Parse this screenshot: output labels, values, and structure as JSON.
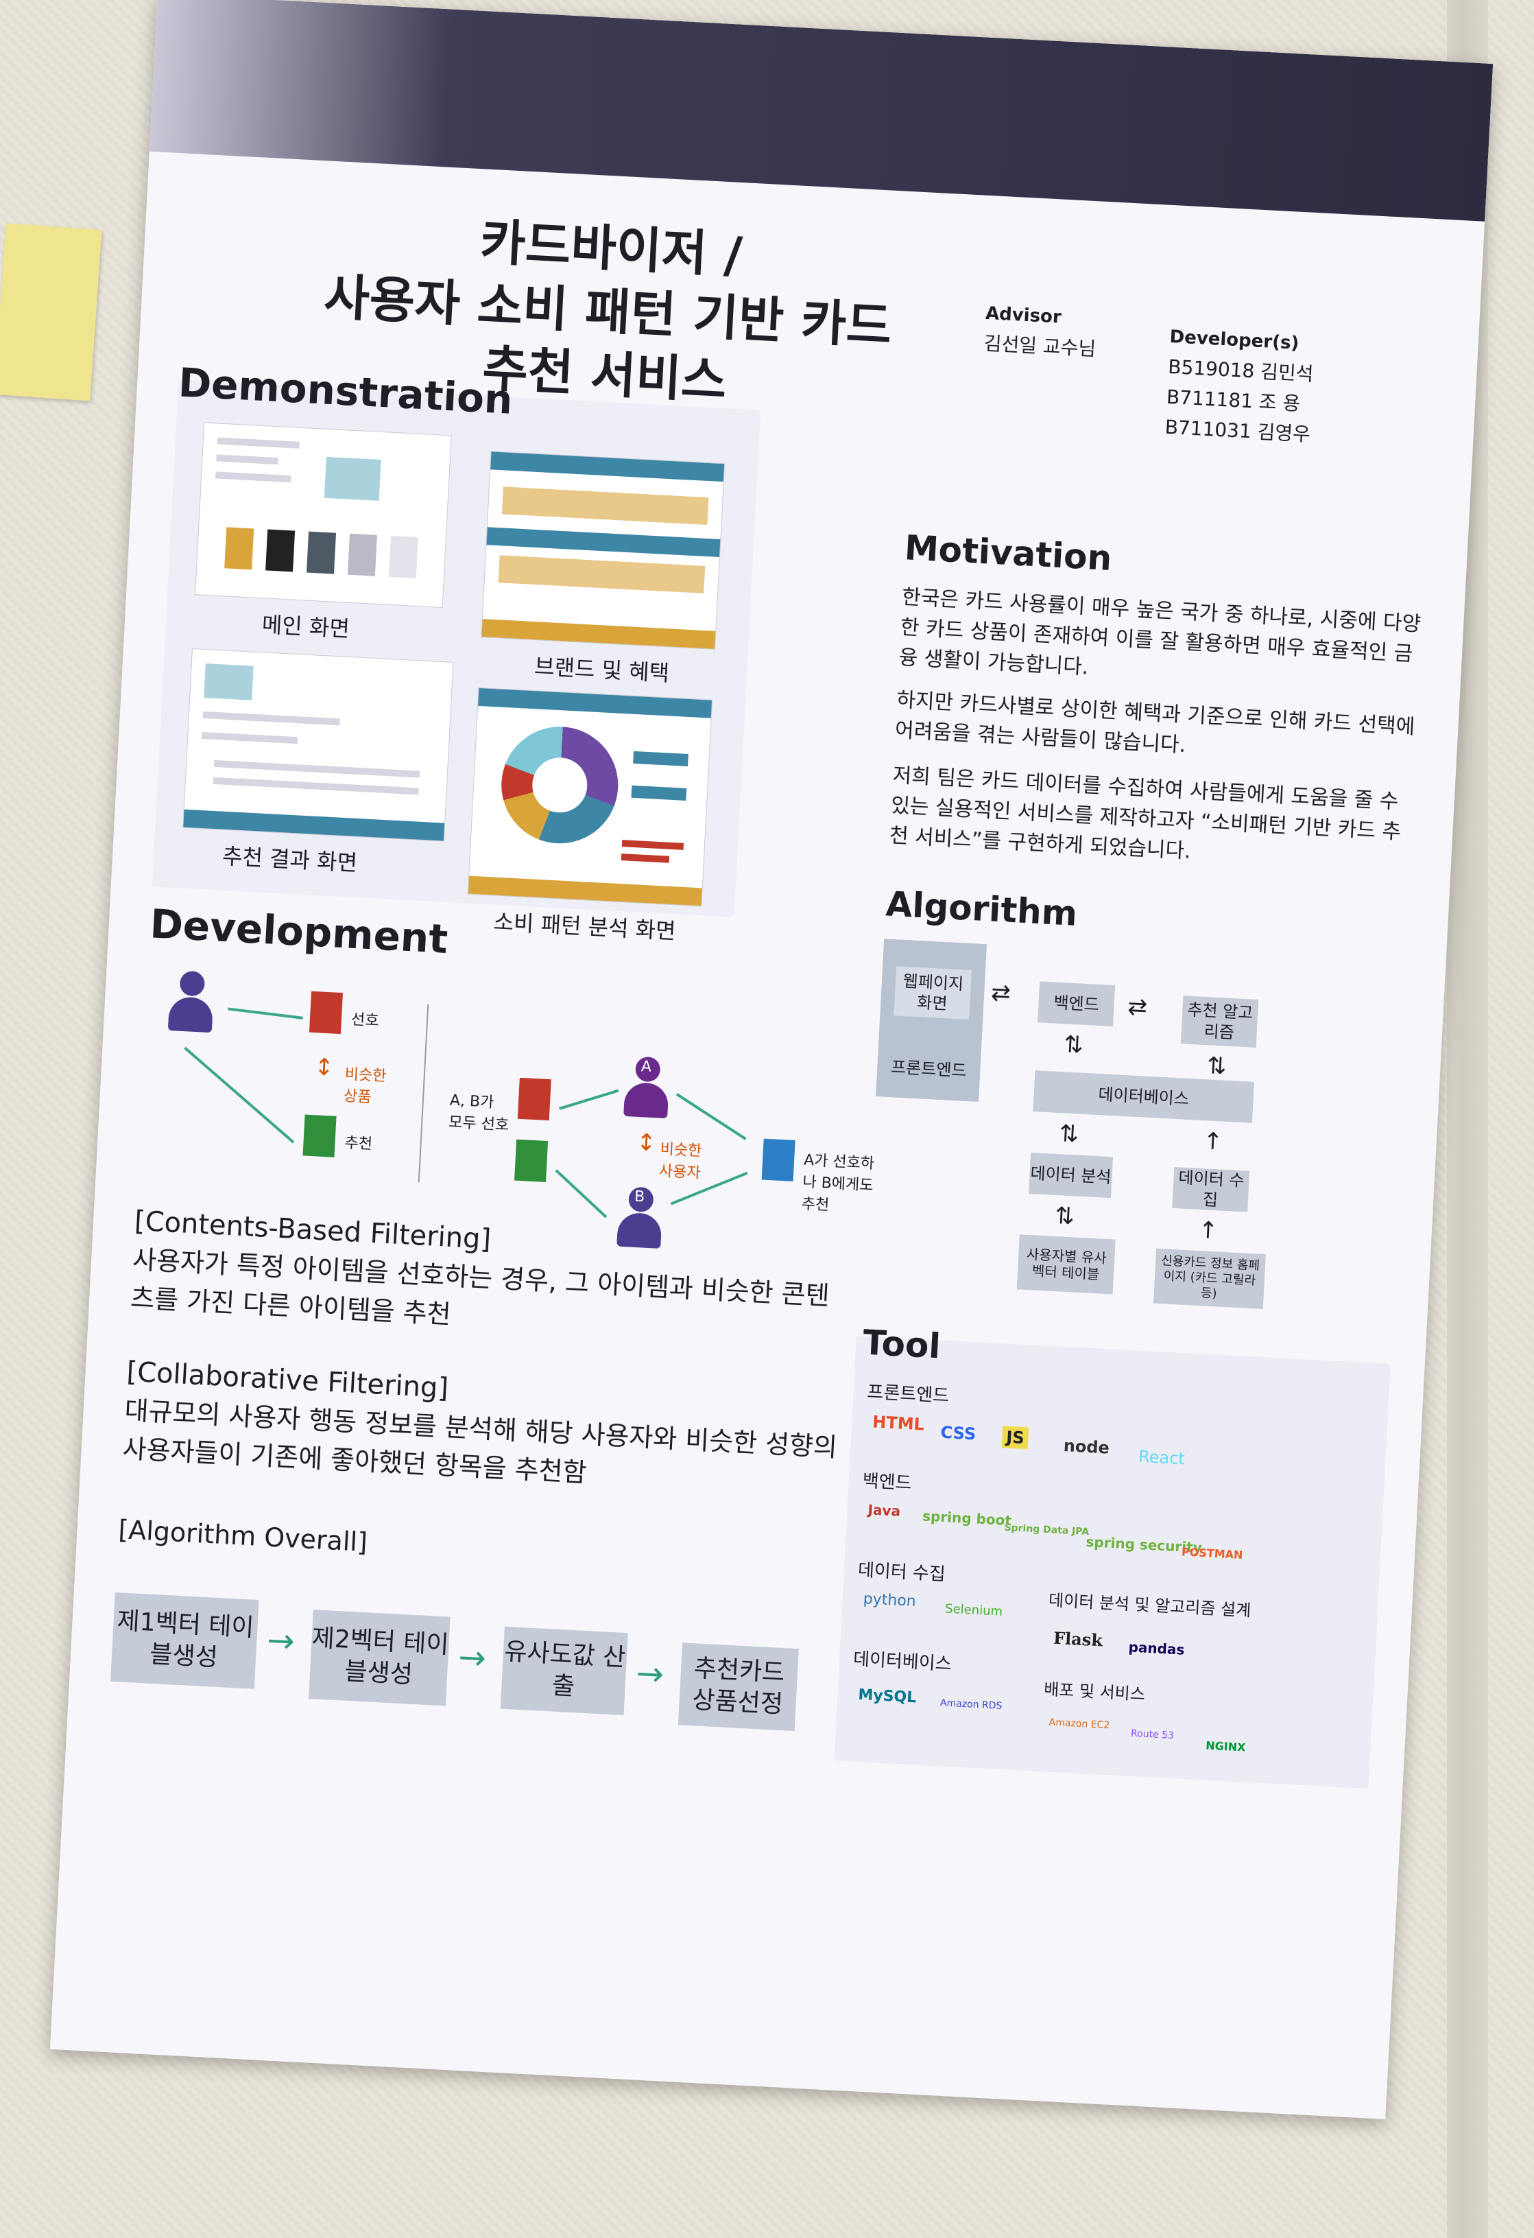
{
  "title": {
    "line1": "카드바이저 /",
    "line2": "사용자 소비 패턴 기반 카드",
    "line3": "추천 서비스"
  },
  "advisor": {
    "label": "Advisor",
    "name": "김선일 교수님"
  },
  "developers": {
    "label": "Developer(s)",
    "list": [
      "B519018 김민석",
      "B711181 조  용",
      "B711031 김영우"
    ]
  },
  "demonstration": {
    "heading": "Demonstration",
    "captions": {
      "main": "메인 화면",
      "brand": "브랜드 및 혜택",
      "result": "추천 결과 화면",
      "analysis": "소비 패턴 분석 화면"
    }
  },
  "motivation": {
    "heading": "Motivation",
    "paragraphs": [
      "한국은 카드 사용률이 매우 높은 국가 중 하나로, 시중에 다양한 카드 상품이 존재하여 이를 잘 활용하면 매우 효율적인 금융 생활이 가능합니다.",
      "하지만 카드사별로 상이한 혜택과 기준으로 인해 카드 선택에 어려움을 겪는 사람들이 많습니다.",
      "저희 팀은 카드 데이터를 수집하여 사람들에게 도움을 줄 수 있는 실용적인 서비스를 제작하고자 “소비패턴 기반 카드 추천 서비스”를 구현하게 되었습니다."
    ]
  },
  "algorithm": {
    "heading": "Algorithm",
    "boxes": {
      "web": "웹페이지 화면",
      "frontend": "프론트엔드",
      "backend": "백엔드",
      "recommend": "추천 알고리즘",
      "database": "데이터베이스",
      "analysis": "데이터 분석",
      "collect": "데이터 수집",
      "user_table": "사용자별 유사 벡터 테이블",
      "source": "신용카드 정보 홈페이지 (카드 고릴라 등)"
    }
  },
  "development": {
    "heading": "Development",
    "diagram": {
      "prefer": "선호",
      "similar_product": "비슷한 상품",
      "recommend": "추천",
      "ab_prefer": "A, B가 모두 선호",
      "similar_user": "비슷한 사용자",
      "a_pref_b_rec": "A가 선호하나 B에게도 추천",
      "a": "A",
      "b": "B"
    },
    "cbf_title": "[Contents-Based Filtering]",
    "cbf_text": "사용자가 특정 아이템을 선호하는 경우, 그 아이템과 비슷한 콘텐츠를 가진 다른 아이템을 추천",
    "cf_title": "[Collaborative Filtering]",
    "cf_text": "대규모의 사용자 행동 정보를 분석해 해당 사용자와 비슷한 성향의 사용자들이 기존에 좋아했던 항목을 추천함",
    "overall_title": "[Algorithm Overall]",
    "flow": [
      "제1벡터 테이블생성",
      "제2벡터 테이블생성",
      "유사도값 산출",
      "추천카드 상품선정"
    ]
  },
  "tool": {
    "heading": "Tool",
    "frontend": {
      "label": "프론트엔드",
      "items": [
        "HTML",
        "CSS",
        "JS",
        "node",
        "React"
      ]
    },
    "backend": {
      "label": "백엔드",
      "items": [
        "Java",
        "spring boot",
        "Spring Data JPA",
        "spring security",
        "POSTMAN"
      ]
    },
    "collect": {
      "label": "데이터 수집",
      "items": [
        "python",
        "Selenium"
      ]
    },
    "analysis": {
      "label": "데이터 분석 및 알고리즘 설계",
      "items": [
        "Flask",
        "pandas"
      ]
    },
    "database": {
      "label": "데이터베이스",
      "items": [
        "MySQL",
        "Amazon RDS"
      ]
    },
    "deploy": {
      "label": "배포 및 서비스",
      "items": [
        "Amazon EC2",
        "Route 53",
        "NGINX"
      ]
    }
  },
  "colors": {
    "banner": "#2d2b40",
    "accent_teal": "#3aa68a",
    "person_purple": "#4b3d8f",
    "doc_red": "#c0392b",
    "doc_green": "#2f8f3a",
    "doc_blue": "#2c7fc4"
  }
}
